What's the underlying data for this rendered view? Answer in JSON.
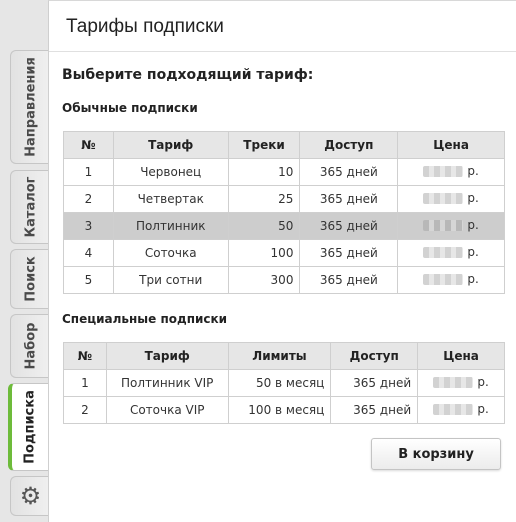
{
  "tabs": [
    {
      "label": "Направления",
      "active": false
    },
    {
      "label": "Каталог",
      "active": false
    },
    {
      "label": "Поиск",
      "active": false
    },
    {
      "label": "Набор",
      "active": false
    },
    {
      "label": "Подписка",
      "active": true
    },
    {
      "icon": "gear-icon"
    }
  ],
  "panel": {
    "title": "Тарифы подписки",
    "choose_label": "Выберите подходящий тариф:"
  },
  "regular": {
    "title": "Обычные подписки",
    "headers": [
      "№",
      "Тариф",
      "Треки",
      "Доступ",
      "Цена"
    ],
    "rows": [
      {
        "num": "1",
        "name": "Червонец",
        "tracks": "10",
        "access": "365 дней",
        "currency": "р."
      },
      {
        "num": "2",
        "name": "Четвертак",
        "tracks": "25",
        "access": "365 дней",
        "currency": "р."
      },
      {
        "num": "3",
        "name": "Полтинник",
        "tracks": "50",
        "access": "365 дней",
        "currency": "р."
      },
      {
        "num": "4",
        "name": "Соточка",
        "tracks": "100",
        "access": "365 дней",
        "currency": "р."
      },
      {
        "num": "5",
        "name": "Три сотни",
        "tracks": "300",
        "access": "365 дней",
        "currency": "р."
      }
    ],
    "highlighted_row": 3
  },
  "special": {
    "title": "Специальные подписки",
    "headers": [
      "№",
      "Тариф",
      "Лимиты",
      "Доступ",
      "Цена"
    ],
    "rows": [
      {
        "num": "1",
        "name": "Полтинник VIP",
        "limits": "50 в месяц",
        "access": "365 дней",
        "currency": "р."
      },
      {
        "num": "2",
        "name": "Соточка VIP",
        "limits": "100 в месяц",
        "access": "365 дней",
        "currency": "р."
      }
    ]
  },
  "cart_button": "В корзину",
  "colors": {
    "accent": "#6dbb3a",
    "header_bg": "#e6e6e6",
    "highlight_row": "#cdcdcd"
  }
}
